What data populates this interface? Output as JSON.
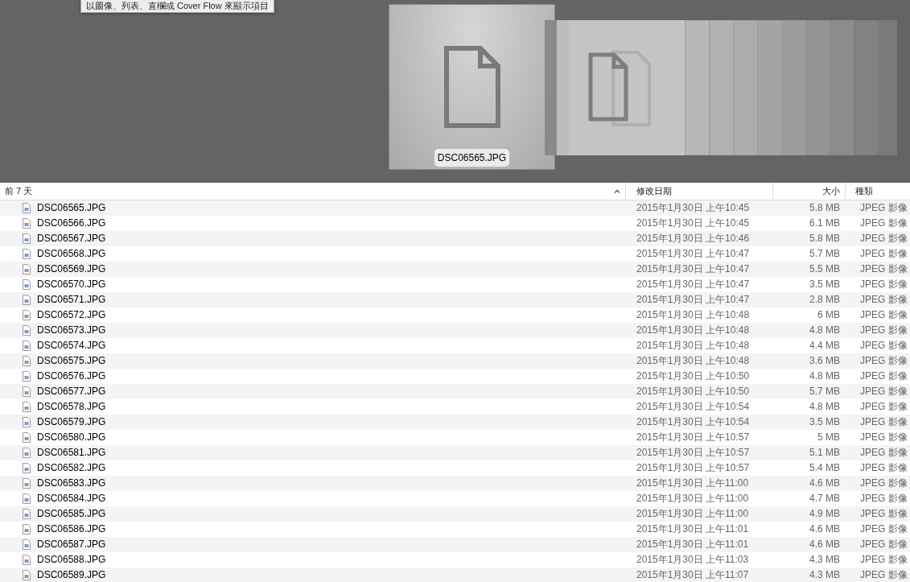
{
  "tooltip": "以圖像、列表、直欄或 Cover Flow 來顯示項目",
  "cover_flow": {
    "selected_caption": "DSC06565.JPG"
  },
  "columns": [
    {
      "label": "前 7 天",
      "sorted": true
    },
    {
      "label": "修改日期",
      "sorted": false
    },
    {
      "label": "大小",
      "sorted": false
    },
    {
      "label": "種類",
      "sorted": false
    }
  ],
  "rows": [
    {
      "name": "DSC06565.JPG",
      "date": "2015年1月30日 上午10:45",
      "size": "5.8 MB",
      "kind": "JPEG 影像"
    },
    {
      "name": "DSC06566.JPG",
      "date": "2015年1月30日 上午10:45",
      "size": "6.1 MB",
      "kind": "JPEG 影像"
    },
    {
      "name": "DSC06567.JPG",
      "date": "2015年1月30日 上午10:46",
      "size": "5.8 MB",
      "kind": "JPEG 影像"
    },
    {
      "name": "DSC06568.JPG",
      "date": "2015年1月30日 上午10:47",
      "size": "5.7 MB",
      "kind": "JPEG 影像"
    },
    {
      "name": "DSC06569.JPG",
      "date": "2015年1月30日 上午10:47",
      "size": "5.5 MB",
      "kind": "JPEG 影像"
    },
    {
      "name": "DSC06570.JPG",
      "date": "2015年1月30日 上午10:47",
      "size": "3.5 MB",
      "kind": "JPEG 影像"
    },
    {
      "name": "DSC06571.JPG",
      "date": "2015年1月30日 上午10:47",
      "size": "2.8 MB",
      "kind": "JPEG 影像"
    },
    {
      "name": "DSC06572.JPG",
      "date": "2015年1月30日 上午10:48",
      "size": "6 MB",
      "kind": "JPEG 影像"
    },
    {
      "name": "DSC06573.JPG",
      "date": "2015年1月30日 上午10:48",
      "size": "4.8 MB",
      "kind": "JPEG 影像"
    },
    {
      "name": "DSC06574.JPG",
      "date": "2015年1月30日 上午10:48",
      "size": "4.4 MB",
      "kind": "JPEG 影像"
    },
    {
      "name": "DSC06575.JPG",
      "date": "2015年1月30日 上午10:48",
      "size": "3.6 MB",
      "kind": "JPEG 影像"
    },
    {
      "name": "DSC06576.JPG",
      "date": "2015年1月30日 上午10:50",
      "size": "4.8 MB",
      "kind": "JPEG 影像"
    },
    {
      "name": "DSC06577.JPG",
      "date": "2015年1月30日 上午10:50",
      "size": "5.7 MB",
      "kind": "JPEG 影像"
    },
    {
      "name": "DSC06578.JPG",
      "date": "2015年1月30日 上午10:54",
      "size": "4.8 MB",
      "kind": "JPEG 影像"
    },
    {
      "name": "DSC06579.JPG",
      "date": "2015年1月30日 上午10:54",
      "size": "3.5 MB",
      "kind": "JPEG 影像"
    },
    {
      "name": "DSC06580.JPG",
      "date": "2015年1月30日 上午10:57",
      "size": "5 MB",
      "kind": "JPEG 影像"
    },
    {
      "name": "DSC06581.JPG",
      "date": "2015年1月30日 上午10:57",
      "size": "5.1 MB",
      "kind": "JPEG 影像"
    },
    {
      "name": "DSC06582.JPG",
      "date": "2015年1月30日 上午10:57",
      "size": "5.4 MB",
      "kind": "JPEG 影像"
    },
    {
      "name": "DSC06583.JPG",
      "date": "2015年1月30日 上午11:00",
      "size": "4.6 MB",
      "kind": "JPEG 影像"
    },
    {
      "name": "DSC06584.JPG",
      "date": "2015年1月30日 上午11:00",
      "size": "4.7 MB",
      "kind": "JPEG 影像"
    },
    {
      "name": "DSC06585.JPG",
      "date": "2015年1月30日 上午11:00",
      "size": "4.9 MB",
      "kind": "JPEG 影像"
    },
    {
      "name": "DSC06586.JPG",
      "date": "2015年1月30日 上午11:01",
      "size": "4.6 MB",
      "kind": "JPEG 影像"
    },
    {
      "name": "DSC06587.JPG",
      "date": "2015年1月30日 上午11:01",
      "size": "4.6 MB",
      "kind": "JPEG 影像"
    },
    {
      "name": "DSC06588.JPG",
      "date": "2015年1月30日 上午11:03",
      "size": "4.3 MB",
      "kind": "JPEG 影像"
    },
    {
      "name": "DSC06589.JPG",
      "date": "2015年1月30日 上午11:07",
      "size": "4.3 MB",
      "kind": "JPEG 影像"
    }
  ]
}
